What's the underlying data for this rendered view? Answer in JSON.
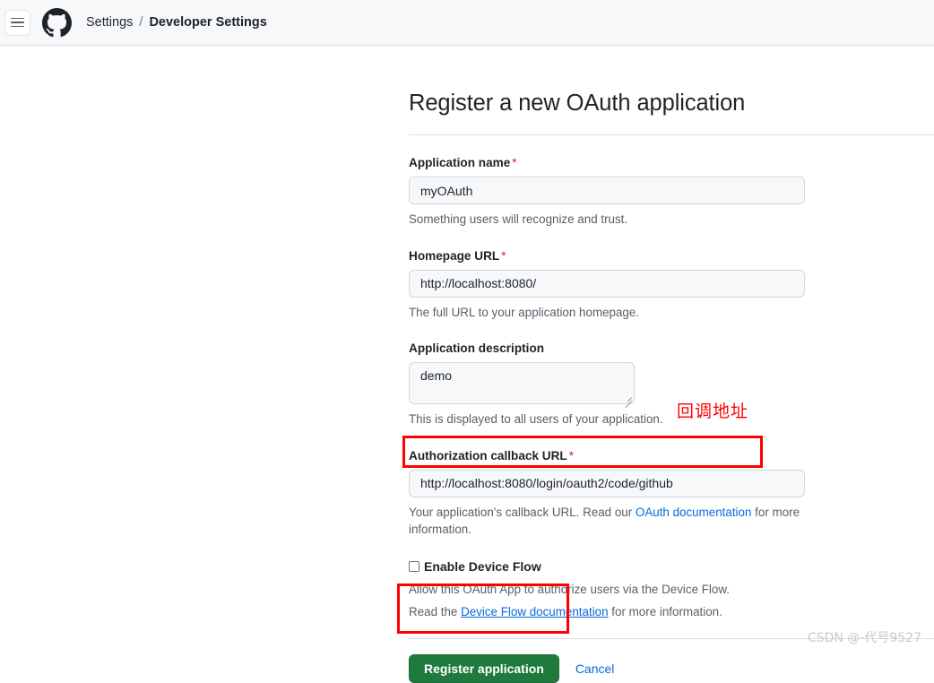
{
  "header": {
    "menu_icon": "hamburger-menu-icon",
    "logo_icon": "github-logo-icon",
    "breadcrumb": {
      "parent": "Settings",
      "separator": "/",
      "current": "Developer Settings"
    }
  },
  "page": {
    "title": "Register a new OAuth application"
  },
  "form": {
    "app_name": {
      "label": "Application name",
      "required_marker": "*",
      "value": "myOAuth",
      "help": "Something users will recognize and trust."
    },
    "homepage_url": {
      "label": "Homepage URL",
      "required_marker": "*",
      "value": "http://localhost:8080/",
      "help": "The full URL to your application homepage."
    },
    "app_description": {
      "label": "Application description",
      "value": "demo",
      "help": "This is displayed to all users of your application."
    },
    "callback_url": {
      "label": "Authorization callback URL",
      "required_marker": "*",
      "value": "http://localhost:8080/login/oauth2/code/github",
      "help_prefix": "Your application's callback URL. Read our ",
      "help_link": "OAuth documentation",
      "help_suffix": " for more information."
    },
    "device_flow": {
      "label": "Enable Device Flow",
      "checked": false,
      "help_line1": "Allow this OAuth App to authorize users via the Device Flow.",
      "help_line2_prefix": "Read the ",
      "help_line2_link": "Device Flow documentation",
      "help_line2_suffix": " for more information."
    }
  },
  "actions": {
    "submit_label": "Register application",
    "cancel_label": "Cancel"
  },
  "annotations": {
    "callback_note": "回调地址",
    "note_color": "#fe0000",
    "highlight_color": "#fe0000"
  },
  "watermark": {
    "text": "CSDN @-代号9527"
  },
  "theme": {
    "header_bg": "#f6f8fa",
    "input_bg": "#f6f8fa",
    "border": "#d0d7de",
    "link": "#0969da",
    "submit_green": "#1f7a3d",
    "required_red": "#cf222e",
    "muted_text": "#57606a"
  }
}
